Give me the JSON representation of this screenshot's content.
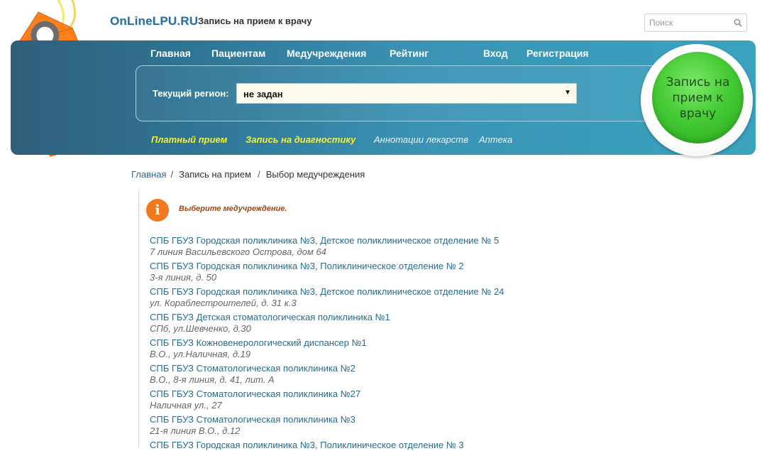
{
  "header": {
    "site_name": "OnLineLPU.RU",
    "tagline": "Запись на прием к врачу",
    "search_placeholder": "Поиск"
  },
  "nav": {
    "items": [
      "Главная",
      "Пациентам",
      "Медучреждения",
      "Рейтинг",
      "Вход",
      "Регистрация"
    ]
  },
  "region": {
    "label": "Текущий регион:",
    "selected": "не задан"
  },
  "subnav": {
    "items": [
      "Платный прием",
      "Запись на диагностику",
      "Аннотации лекарств",
      "Аптека"
    ]
  },
  "cta": {
    "label": "Запись на прием к врачу"
  },
  "breadcrumb": {
    "items": [
      "Главная",
      "Запись на прием",
      "Выбор медучреждения"
    ],
    "separator": "/"
  },
  "info": {
    "icon": "i",
    "text": "Выберите медучреждение."
  },
  "clinics": [
    {
      "name": "СПБ ГБУЗ Городская поликлиника №3, Детское поликлиническое отделение № 5",
      "address": "7 линия Васильевского Острова, дом 64"
    },
    {
      "name": "СПБ ГБУЗ Городская поликлиника №3, Поликлиническое отделение № 2",
      "address": "3-я линия, д. 50"
    },
    {
      "name": "СПБ ГБУЗ Городская поликлиника №3, Детское поликлиническое отделение № 24",
      "address": "ул. Кораблестроителей, д. 31 к.3"
    },
    {
      "name": "СПБ ГБУЗ Детская стоматологическая поликлиника №1",
      "address": "СПб, ул.Шевченко, д.30"
    },
    {
      "name": "СПБ ГБУЗ Кожновенерологический диспансер №1",
      "address": "В.О., ул.Наличная, д.19"
    },
    {
      "name": "СПБ ГБУЗ Стоматологическая поликлиника №2",
      "address": "В.О., 8-я линия, д. 41, лит. А"
    },
    {
      "name": "СПБ ГБУЗ Стоматологическая поликлиника №27",
      "address": "Наличная ул., 27"
    },
    {
      "name": "СПБ ГБУЗ Стоматологическая поликлиника №3",
      "address": "21-я линия В.О., д.12"
    },
    {
      "name": "СПБ ГБУЗ Городская поликлиника №3, Поликлиническое отделение № 3",
      "address": ""
    }
  ],
  "colors": {
    "banner": "#3a93b4",
    "accent_orange": "#f07a22",
    "cta_green": "#46cb35",
    "link": "#2c6a8a",
    "subnav_highlight": "#f4f03a"
  }
}
